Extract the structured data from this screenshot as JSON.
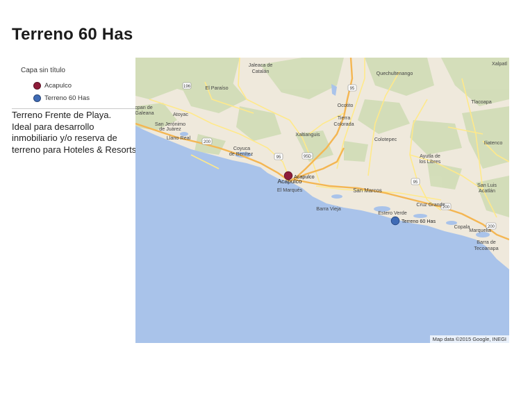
{
  "page": {
    "title": "Terreno 60 Has",
    "description_lines": [
      "Terreno Frente de Playa.",
      "Ideal para desarrollo",
      "inmobiliario y/o reserva de",
      "terreno para Hoteles & Resorts"
    ]
  },
  "legend": {
    "layer_name": "Capa sin título",
    "items": [
      {
        "label": "Acapulco",
        "color": "#8e1c3a",
        "icon": "circle-marker-icon"
      },
      {
        "label": "Terreno 60 Has",
        "color": "#3f6bb5",
        "icon": "circle-marker-icon"
      }
    ]
  },
  "map": {
    "attribution": "Map data ©2015 Google, INEGI",
    "colors": {
      "land": "#efe9dc",
      "water": "#a9c3ea",
      "highway": "#f4b652",
      "road": "#ffe98a",
      "forest": "#cfdcb4"
    },
    "markers": [
      {
        "label": "Acapulco",
        "color": "#8e1c3a"
      },
      {
        "label": "Terreno 60 Has",
        "color": "#3f6bb5"
      }
    ],
    "places": [
      "Jaleaca de",
      "Catalán",
      "Quechultenango",
      "Xalpatl",
      "El Paraíso",
      "Ocotito",
      "Tierra",
      "Colorada",
      "Tlacoapa",
      "ecpan de",
      "Galeana",
      "Atoyac",
      "San Jerónimo",
      "de Juárez",
      "Xaltianguis",
      "Colotepec",
      "Llano Real",
      "Iliatenco",
      "Coyuca",
      "de Benítez",
      "Ayutla de",
      "los Libres",
      "Acapulco",
      "El Marqués",
      "San Marcos",
      "San Luis",
      "Acatlán",
      "Estero Verde",
      "Cruz Grande",
      "Barra Vieja",
      "Copala",
      "Marquelia",
      "Barra de",
      "Tecoanapa"
    ],
    "shields": [
      "196",
      "95",
      "95D",
      "200",
      "95",
      "95",
      "200",
      "200"
    ]
  }
}
